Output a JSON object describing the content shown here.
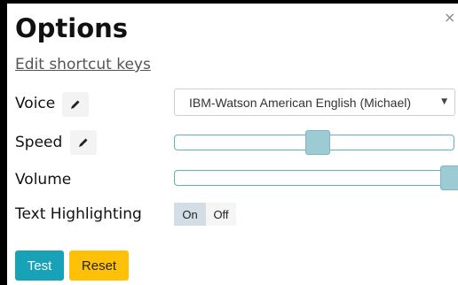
{
  "dialog": {
    "title": "Options",
    "close_glyph": "×",
    "edit_shortcut_link": "Edit shortcut keys"
  },
  "settings": {
    "voice": {
      "label": "Voice",
      "edit_icon": "pencil-icon",
      "selected": "IBM-Watson American English (Michael)"
    },
    "speed": {
      "label": "Speed",
      "edit_icon": "pencil-icon",
      "level": 0.5
    },
    "volume": {
      "label": "Volume",
      "level": 1.0
    },
    "text_highlighting": {
      "label": "Text Highlighting",
      "on_label": "On",
      "off_label": "Off",
      "selected": "On"
    }
  },
  "buttons": {
    "test_label": "Test",
    "reset_label": "Reset"
  },
  "colors": {
    "test_button": "#17a2b8",
    "reset_button": "#ffc107",
    "slider_border": "#5fb2c0",
    "slider_thumb": "#9ccbd3",
    "toggle_selected": "#d3dde6"
  }
}
